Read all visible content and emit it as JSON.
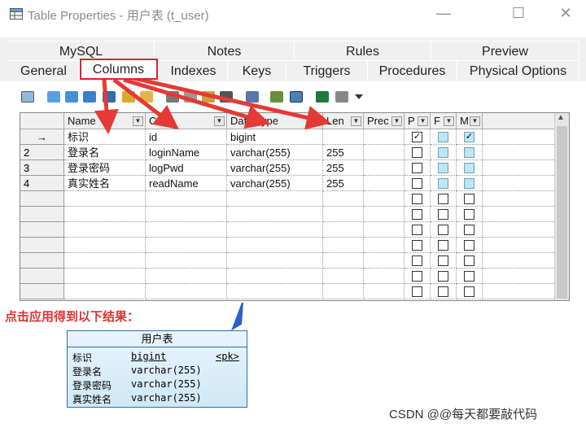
{
  "window": {
    "title": "Table Properties - 用户表 (t_user)",
    "minimize": "—",
    "maximize": "☐",
    "close": "✕"
  },
  "tabs_row1": [
    {
      "label": "MySQL"
    },
    {
      "label": "Notes"
    },
    {
      "label": "Rules"
    },
    {
      "label": "Preview"
    }
  ],
  "tabs_row2": [
    {
      "label": "General"
    },
    {
      "label": "Columns",
      "selected": true
    },
    {
      "label": "Indexes"
    },
    {
      "label": "Keys"
    },
    {
      "label": "Triggers"
    },
    {
      "label": "Procedures"
    },
    {
      "label": "Physical Options"
    }
  ],
  "grid": {
    "headers": [
      "Name",
      "Code",
      "Data Type",
      "Len",
      "Prec",
      "P",
      "F",
      "M"
    ],
    "rows": [
      {
        "num": "→",
        "name": "标识",
        "code": "id",
        "type": "bigint",
        "len": "",
        "p": true,
        "m": true
      },
      {
        "num": "2",
        "name": "登录名",
        "code": "loginName",
        "type": "varchar(255)",
        "len": "255",
        "p": false,
        "m": false
      },
      {
        "num": "3",
        "name": "登录密码",
        "code": "logPwd",
        "type": "varchar(255)",
        "len": "255",
        "p": false,
        "m": false
      },
      {
        "num": "4",
        "name": "真实姓名",
        "code": "readName",
        "type": "varchar(255)",
        "len": "255",
        "p": false,
        "m": false
      }
    ],
    "empty_rows": 7
  },
  "annotation": "点击应用得到以下结果：",
  "entity": {
    "title": "用户表",
    "pk_label": "<pk>",
    "rows": [
      {
        "name": "标识",
        "type": "bigint"
      },
      {
        "name": "登录名",
        "type": "varchar(255)"
      },
      {
        "name": "登录密码",
        "type": "varchar(255)"
      },
      {
        "name": "真实姓名",
        "type": "varchar(255)"
      }
    ]
  },
  "watermark": "CSDN @@每天都要敲代码",
  "colors": {
    "accent_red": "#d9262b",
    "entity_border": "#2a6fb0"
  }
}
